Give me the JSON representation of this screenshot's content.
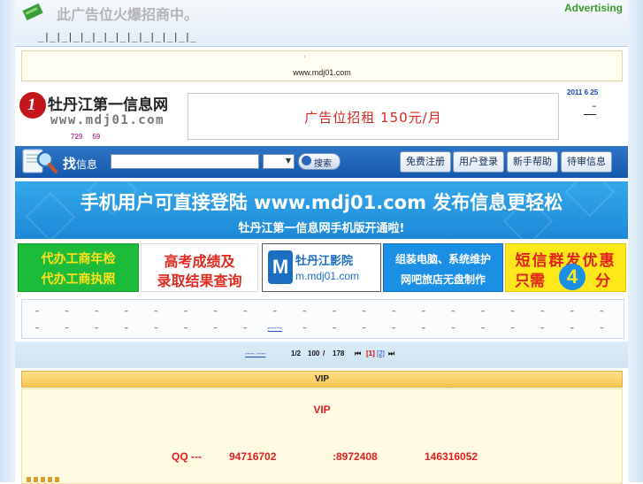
{
  "top_ad": {
    "slogan": "此广告位火爆招商中。",
    "brand": "Advertising",
    "dashes": "_|_|_|_|_|_|_|_|_|_|_|_|_|_"
  },
  "url_strip": {
    "dot": "·",
    "url": "www.mdj01.com"
  },
  "logo": {
    "glyph": "1",
    "title": "牡丹江第一信息网",
    "domain": "www.mdj01.com",
    "stats_a": "729",
    "stats_b": "59"
  },
  "rent_ad": {
    "text": "广告位招租 150元/月"
  },
  "date": {
    "text": "2011  6  25",
    "dash": "–"
  },
  "search": {
    "label_big": "找",
    "label_small": "信息",
    "input_value": "",
    "select_value": "",
    "button_label": "搜索"
  },
  "nav": {
    "register": "免费注册",
    "login": "用户登录",
    "help": "新手帮助",
    "pending": "待审信息"
  },
  "mobile_banner": {
    "main": "手机用户可直接登陆 www.mdj01.com 发布信息更轻松",
    "sub": "牡丹江第一信息网手机版开通啦!"
  },
  "tiles": {
    "green_l1": "代办工商年检",
    "green_l2": "代办工商执照",
    "red_l1": "高考成绩及",
    "red_l2": "录取结果查询",
    "cinema_badge": "M",
    "cinema_name": "牡丹江影院",
    "cinema_url": "m.mdj01.com",
    "blue_l1": "组装电脑、系统维护",
    "blue_l2": "网吧旅店无盘制作",
    "yellow_l1": "短信群发优惠",
    "yellow_l2": "只需",
    "yellow_four": "4",
    "yellow_l3": "分"
  },
  "categories": {
    "row1": [
      "–",
      "–",
      "–",
      "–",
      "–",
      "–",
      "–",
      "–",
      "–",
      "–",
      "–",
      "–",
      "–",
      "–",
      "–",
      "–",
      "–",
      "–",
      "–",
      "–"
    ],
    "row2": [
      "–",
      "–",
      "–",
      "–",
      "–",
      "–",
      "–",
      "–",
      "-----",
      "–",
      "–",
      "–",
      "–",
      "–",
      "–",
      "–",
      "–",
      "–",
      "–",
      "–"
    ]
  },
  "pager": {
    "prefix": "---- ----",
    "page_of": "1/2",
    "per_page": "100",
    "slash": "/",
    "total": "178",
    "first": "⏮",
    "current": "[1]",
    "next_page": "[2]",
    "last": "⏭"
  },
  "vip": {
    "header": "VIP",
    "title": "VIP",
    "qq_label": "QQ ---",
    "qq1": "94716702",
    "qq2": ":8972408",
    "qq3": "146316052"
  },
  "colors": {
    "search_bar": "#1458ad",
    "banner": "#1c89d8",
    "vip_red": "#e02020"
  }
}
